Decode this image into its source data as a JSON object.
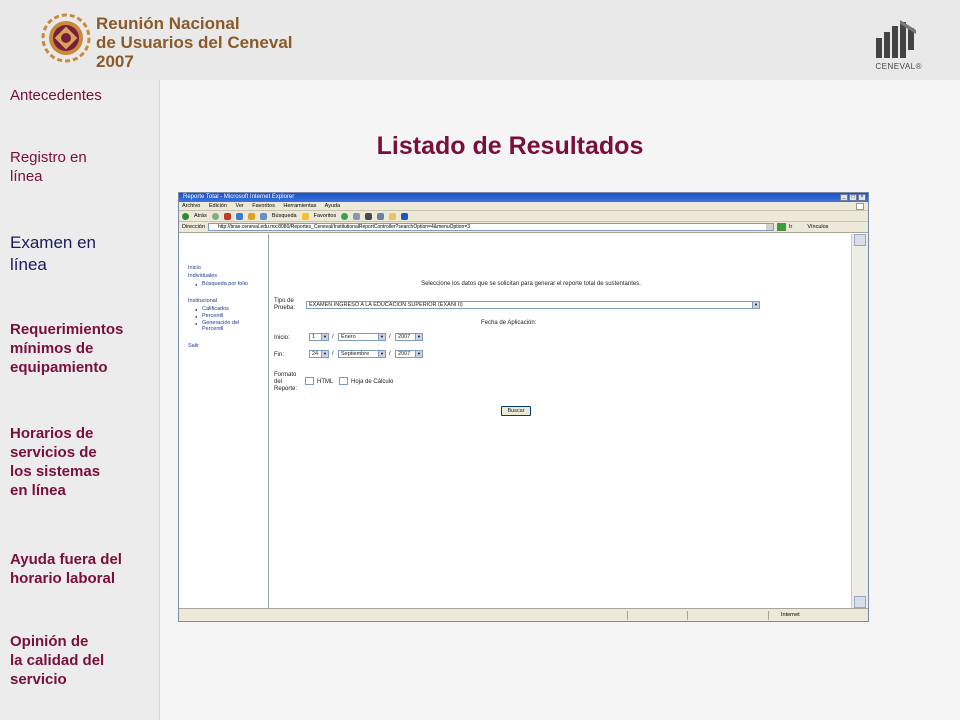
{
  "header": {
    "event_title_line1": "Reunión Nacional",
    "event_title_line2": "de Usuarios del Ceneval",
    "event_title_line3": "2007",
    "brand": "CENEVAL®"
  },
  "sidebar": {
    "items": [
      {
        "label_lines": [
          "Antecedentes"
        ]
      },
      {
        "label_lines": [
          "Registro en",
          "línea"
        ]
      },
      {
        "label_lines": [
          "Examen en",
          "línea"
        ]
      },
      {
        "label_lines": [
          "Requerimientos",
          "mínimos de",
          "equipamiento"
        ]
      },
      {
        "label_lines": [
          "Horarios de",
          "servicios de",
          "los sistemas",
          "en línea"
        ]
      },
      {
        "label_lines": [
          "Ayuda fuera del",
          "horario laboral"
        ]
      },
      {
        "label_lines": [
          "Opinión de",
          "la calidad del",
          "servicio"
        ]
      }
    ]
  },
  "main": {
    "title": "Listado de Resultados"
  },
  "browser": {
    "window_title": "Reporte Total - Microsoft Internet Explorer",
    "menu": [
      "Archivo",
      "Edición",
      "Ver",
      "Favoritos",
      "Herramientas",
      "Ayuda"
    ],
    "toolbar": {
      "back": "Atrás",
      "search": "Búsqueda",
      "favorites": "Favoritos"
    },
    "address_label": "Dirección",
    "address": "http://brae.ceneval.edu.mx:8080/Reportes_Ceneval/InstitutionalReportController?searchOption=4&menuOption=3",
    "go_label": "Ir",
    "links_label": "Vínculos",
    "status_zone": "Internet"
  },
  "report_nav": {
    "inicio": "Inicio",
    "individuales": "Individuales",
    "busqueda_folio": "Búsqueda por folio",
    "institucional": "Institucional",
    "calificados": "Calificados",
    "percentil": "Percentil",
    "generacion_percentil_line1": "Generación del",
    "generacion_percentil_line2": "Percentil",
    "salir": "Salir"
  },
  "report_form": {
    "intro": "Seleccione los datos que se solicitan para generar el reporte total de sustentantes.",
    "tipo_prueba_line1": "Tipo de",
    "tipo_prueba_line2": "Prueba:",
    "tipo_prueba_value": "EXAMEN INGRESO A LA EDUCACIÓN SUPERIOR (EXANI II)",
    "fecha_aplicacion": "Fecha de Aplicación:",
    "inicio_label": "Inicio:",
    "inicio_day": "1",
    "inicio_month": "Enero",
    "inicio_year": "2007",
    "fin_label": "Fin:",
    "fin_day": "24",
    "fin_month": "Septiembre",
    "fin_year": "2007",
    "separator": "/",
    "formato_line1": "Formato",
    "formato_line2": "del",
    "formato_line3": "Reporte:",
    "opt_html": "HTML",
    "opt_hoja": "Hoja de Cálculo",
    "buscar": "Buscar"
  }
}
